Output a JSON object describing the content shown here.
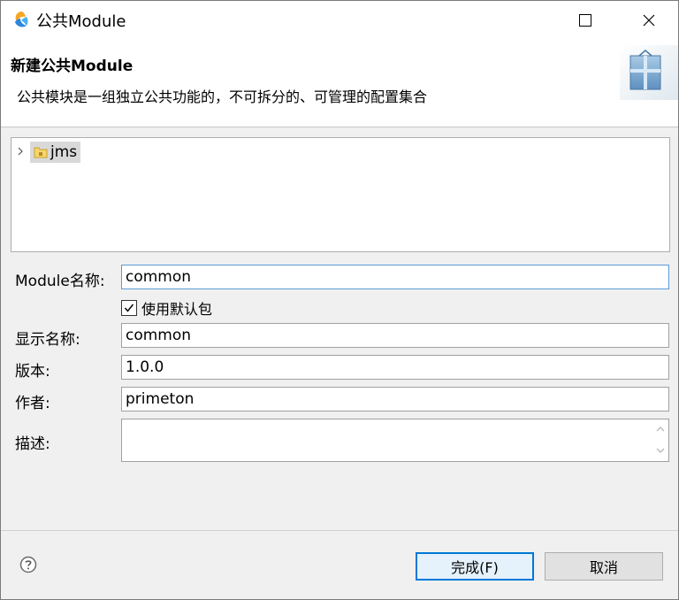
{
  "window": {
    "title": "公共Module"
  },
  "banner": {
    "title": "新建公共Module",
    "description": "公共模块是一组独立公共功能的，不可拆分的、可管理的配置集合"
  },
  "tree": {
    "items": [
      {
        "label": "jms"
      }
    ]
  },
  "form": {
    "module_name": {
      "label": "Module名称:",
      "value": "common"
    },
    "use_default_package": {
      "label": "使用默认包",
      "checked": true
    },
    "display_name": {
      "label": "显示名称:",
      "value": "common"
    },
    "version": {
      "label": "版本:",
      "value": "1.0.0"
    },
    "author": {
      "label": "作者:",
      "value": "primeton"
    },
    "description": {
      "label": "描述:",
      "value": ""
    }
  },
  "buttons": {
    "finish": "完成(F)",
    "cancel": "取消"
  },
  "colors": {
    "focus_border": "#5b9bd5",
    "default_button_border": "#0078d7"
  }
}
